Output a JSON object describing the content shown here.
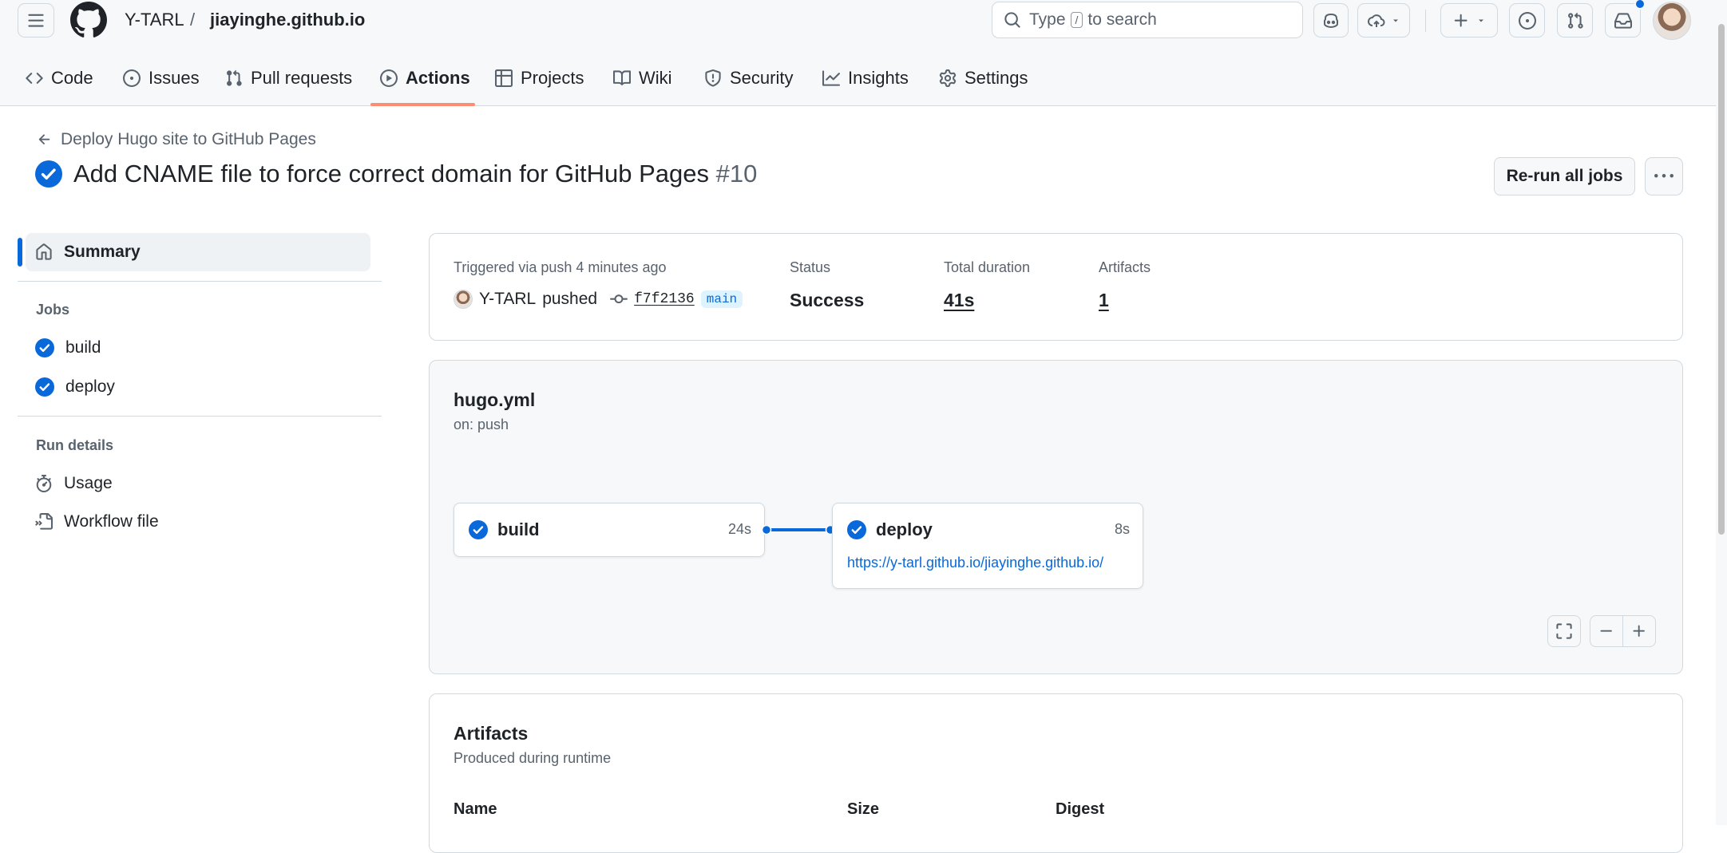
{
  "header": {
    "owner": "Y-TARL",
    "separator": "/",
    "repo": "jiayinghe.github.io",
    "search": {
      "prefix": "Type",
      "key": "/",
      "suffix": "to search"
    }
  },
  "nav": {
    "tabs": [
      {
        "label": "Code",
        "icon": "code-icon"
      },
      {
        "label": "Issues",
        "icon": "issue-opened-icon"
      },
      {
        "label": "Pull requests",
        "icon": "git-pull-request-icon"
      },
      {
        "label": "Actions",
        "icon": "play-icon",
        "active": true
      },
      {
        "label": "Projects",
        "icon": "table-icon"
      },
      {
        "label": "Wiki",
        "icon": "book-icon"
      },
      {
        "label": "Security",
        "icon": "shield-icon"
      },
      {
        "label": "Insights",
        "icon": "graph-icon"
      },
      {
        "label": "Settings",
        "icon": "gear-icon"
      }
    ],
    "active_color": "#fd8c73"
  },
  "run": {
    "back_label": "Deploy Hugo site to GitHub Pages",
    "title": "Add CNAME file to force correct domain for GitHub Pages",
    "number": "#10",
    "rerun_label": "Re-run all jobs",
    "status_color": "#0969da"
  },
  "sidebar": {
    "summary": "Summary",
    "jobs_heading": "Jobs",
    "jobs": [
      "build",
      "deploy"
    ],
    "details_heading": "Run details",
    "usage": "Usage",
    "workflow_file": "Workflow file"
  },
  "summary": {
    "trigger_label": "Triggered via push 4 minutes ago",
    "actor": "Y-TARL",
    "action": "pushed",
    "sha": "f7f2136",
    "branch": "main",
    "status_label": "Status",
    "status_value": "Success",
    "duration_label": "Total duration",
    "duration_value": "41s",
    "artifacts_label": "Artifacts",
    "artifacts_value": "1"
  },
  "graph": {
    "file": "hugo.yml",
    "trigger": "on: push",
    "build": {
      "name": "build",
      "duration": "24s"
    },
    "deploy": {
      "name": "deploy",
      "duration": "8s",
      "url": "https://y-tarl.github.io/jiayinghe.github.io/"
    }
  },
  "artifacts": {
    "title": "Artifacts",
    "subtitle": "Produced during runtime",
    "columns": [
      "Name",
      "Size",
      "Digest"
    ]
  }
}
